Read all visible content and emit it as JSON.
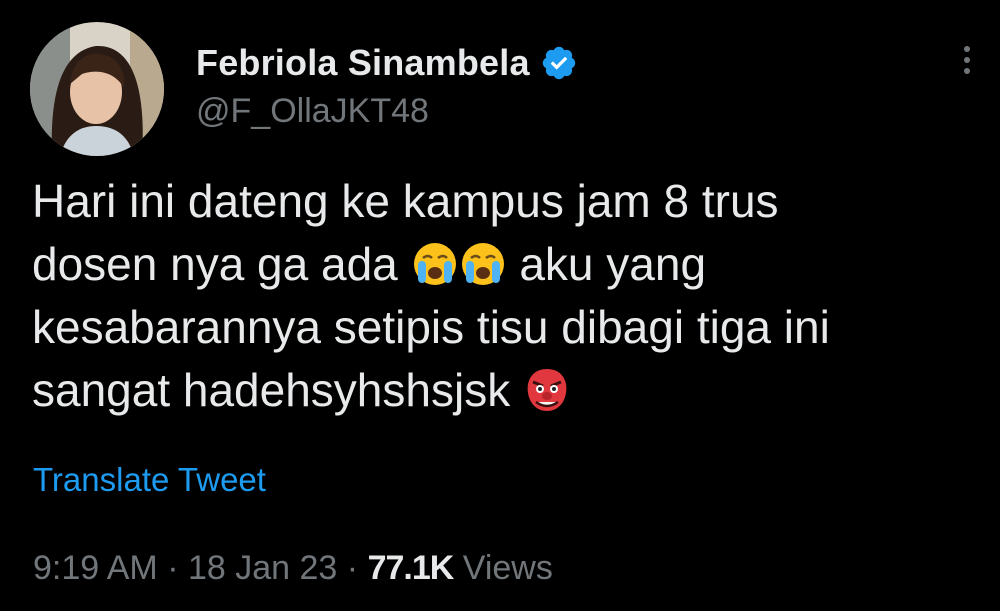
{
  "user": {
    "display_name": "Febriola Sinambela",
    "handle": "@F_OllaJKT48",
    "verified": true,
    "avatar_icon": "profile-photo"
  },
  "more_icon": "vertical-ellipsis-icon",
  "tweet": {
    "lines": [
      "Hari ini dateng ke kampus jam 8 trus",
      "dosen nya ga ada",
      "aku yang",
      "kesabarannya setipis tisu dibagi tiga ini",
      "sangat hadehsyhshsjsk"
    ],
    "emojis": [
      "crying-face-emoji",
      "crying-face-emoji",
      "goblin-mask-emoji"
    ]
  },
  "translate_label": "Translate Tweet",
  "meta": {
    "time": "9:19 AM",
    "separator": "·",
    "date": "18 Jan 23",
    "views_count": "77.1K",
    "views_label": "Views"
  },
  "colors": {
    "background": "#000000",
    "text": "#e7e9ea",
    "secondary": "#71767b",
    "accent": "#1d9bf0"
  }
}
